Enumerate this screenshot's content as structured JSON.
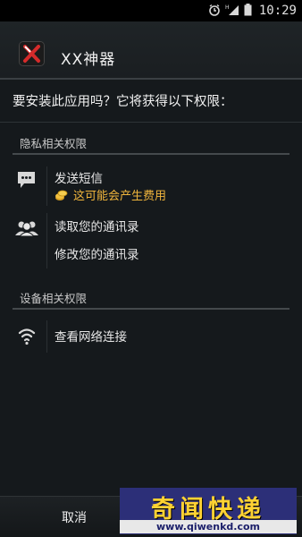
{
  "status_bar": {
    "time": "10:29",
    "icons": [
      "alarm-icon",
      "signal-icon",
      "battery-icon"
    ]
  },
  "header": {
    "app_title": "XX神器",
    "app_icon": "app-logo-icon"
  },
  "question": "要安装此应用吗？它将获得以下权限：",
  "sections": [
    {
      "title": "隐私相关权限",
      "permissions": [
        {
          "icon": "sms-icon",
          "label": "发送短信",
          "warning": "这可能会产生费用",
          "warning_icon": "coins-icon"
        },
        {
          "icon": "contacts-icon",
          "labels": [
            "读取您的通讯录",
            "修改您的通讯录"
          ]
        }
      ]
    },
    {
      "title": "设备相关权限",
      "permissions": [
        {
          "icon": "wifi-icon",
          "label": "查看网络连接"
        }
      ]
    }
  ],
  "bottom_bar": {
    "cancel_label": "取消"
  },
  "watermark": {
    "text": "奇闻快递",
    "url": "www.qiwenkd.com"
  },
  "colors": {
    "background": "#15191c",
    "warning_text": "#f0b53c",
    "watermark_bg": "#2c2f78",
    "watermark_text": "#ffd233"
  }
}
